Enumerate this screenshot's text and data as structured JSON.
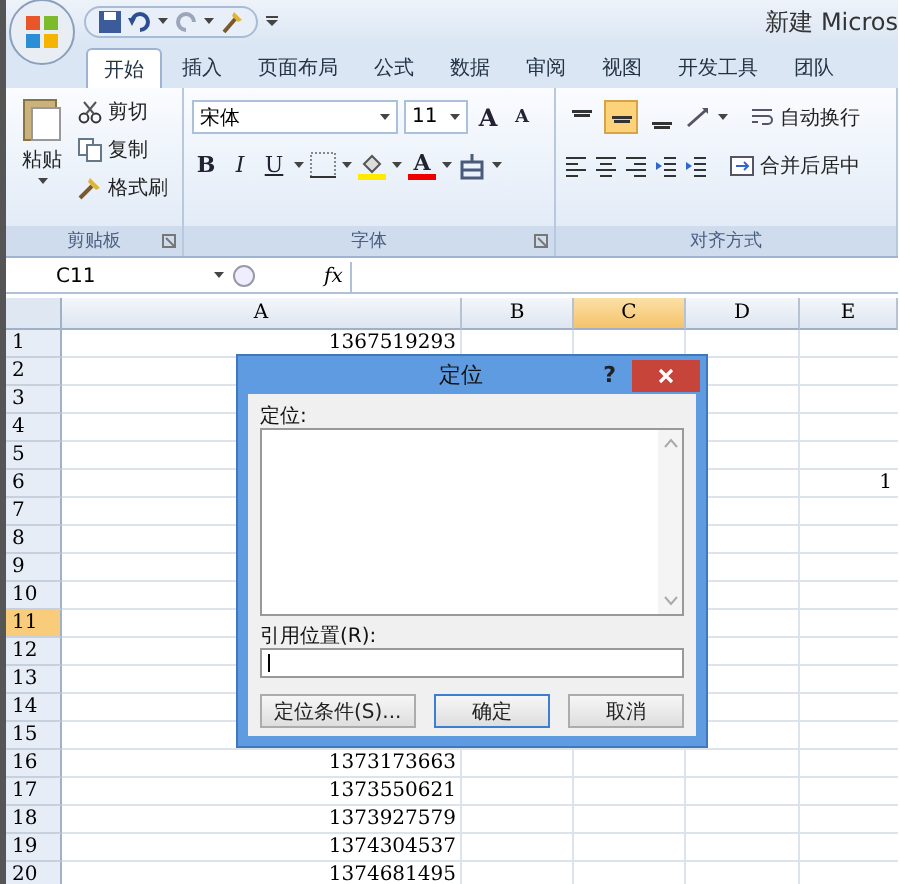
{
  "title_bar": {
    "title": "新建 Micros"
  },
  "tabs": [
    {
      "label": "开始",
      "selected": true
    },
    {
      "label": "插入",
      "selected": false
    },
    {
      "label": "页面布局",
      "selected": false
    },
    {
      "label": "公式",
      "selected": false
    },
    {
      "label": "数据",
      "selected": false
    },
    {
      "label": "审阅",
      "selected": false
    },
    {
      "label": "视图",
      "selected": false
    },
    {
      "label": "开发工具",
      "selected": false
    },
    {
      "label": "团队",
      "selected": false
    }
  ],
  "clipboard": {
    "label": "剪贴板",
    "paste": "粘贴",
    "items": [
      "剪切",
      "复制",
      "格式刷"
    ]
  },
  "font": {
    "label": "字体",
    "font_name": "宋体",
    "font_size": "11",
    "grow": "A",
    "shrink": "A",
    "bold": "B",
    "italic": "I",
    "underline": "U",
    "font_color": "A"
  },
  "alignment": {
    "label": "对齐方式",
    "vertical": [
      {
        "kind": "top",
        "selected": false
      },
      {
        "kind": "middle",
        "selected": true
      },
      {
        "kind": "bottom",
        "selected": false
      }
    ],
    "wrap_text": "自动换行",
    "merge": "合并后居中"
  },
  "formula_bar": {
    "name_box": "C11",
    "fx": "fx"
  },
  "sheet": {
    "columns": [
      {
        "label": "A",
        "selected": false
      },
      {
        "label": "B",
        "selected": false
      },
      {
        "label": "C",
        "selected": true
      },
      {
        "label": "D",
        "selected": false
      },
      {
        "label": "E",
        "selected": false
      }
    ],
    "rows": [
      {
        "number": "1",
        "selected": false,
        "a": "1367519293"
      },
      {
        "number": "2",
        "selected": false
      },
      {
        "number": "3",
        "selected": false
      },
      {
        "number": "4",
        "selected": false
      },
      {
        "number": "5",
        "selected": false
      },
      {
        "number": "6",
        "selected": false,
        "e": "1"
      },
      {
        "number": "7",
        "selected": false
      },
      {
        "number": "8",
        "selected": false
      },
      {
        "number": "9",
        "selected": false
      },
      {
        "number": "10",
        "selected": false
      },
      {
        "number": "11",
        "selected": true
      },
      {
        "number": "12",
        "selected": false
      },
      {
        "number": "13",
        "selected": false
      },
      {
        "number": "14",
        "selected": false
      },
      {
        "number": "15",
        "selected": false
      },
      {
        "number": "16",
        "selected": false,
        "a": "1373173663"
      },
      {
        "number": "17",
        "selected": false,
        "a": "1373550621"
      },
      {
        "number": "18",
        "selected": false,
        "a": "1373927579"
      },
      {
        "number": "19",
        "selected": false,
        "a": "1374304537"
      },
      {
        "number": "20",
        "selected": false,
        "a": "1374681495"
      }
    ]
  },
  "dialog": {
    "title": "定位",
    "help": "?",
    "list_label": "定位:",
    "reference_label": "引用位置(R):",
    "buttons": [
      {
        "label": "定位条件(S)...",
        "default": false
      },
      {
        "label": "确定",
        "default": true
      },
      {
        "label": "取消",
        "default": false
      }
    ]
  }
}
